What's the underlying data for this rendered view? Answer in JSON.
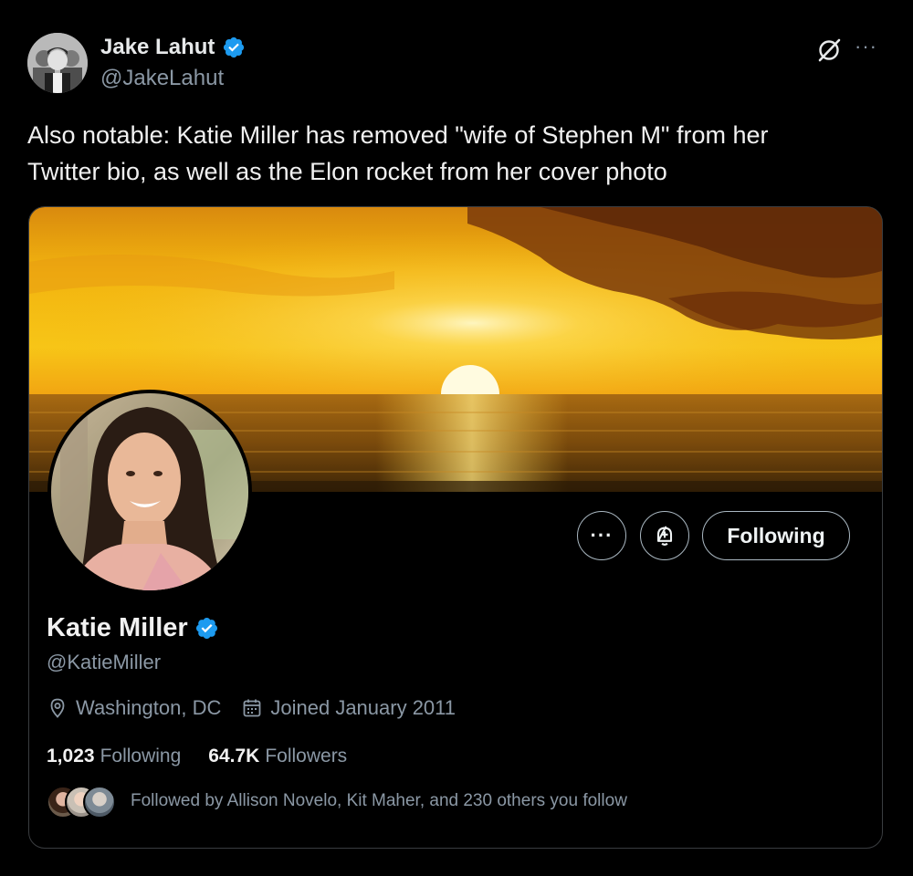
{
  "tweet": {
    "author_name": "Jake Lahut",
    "author_handle": "@JakeLahut",
    "text_line1": "Also notable: Katie Miller has removed \"wife of Stephen M\" from her",
    "text_line2": "Twitter bio, as well as the Elon rocket from her cover photo",
    "more_icon": "···"
  },
  "profile_card": {
    "name": "Katie Miller",
    "handle": "@KatieMiller",
    "location": "Washington, DC",
    "joined": "Joined January 2011",
    "following_count": "1,023",
    "following_label": "Following",
    "followers_count": "64.7K",
    "followers_label": "Followers",
    "followed_by": "Followed by Allison Novelo, Kit Maher, and 230 others you follow",
    "follow_button_label": "Following",
    "more_button_icon": "···"
  },
  "colors": {
    "verified_blue": "#1d9bf0",
    "secondary_text": "#8b98a5",
    "border": "#3a3d40"
  },
  "icons": [
    "verified-icon",
    "grok-icon",
    "more-icon",
    "location-icon",
    "calendar-icon",
    "notification-add-icon"
  ]
}
